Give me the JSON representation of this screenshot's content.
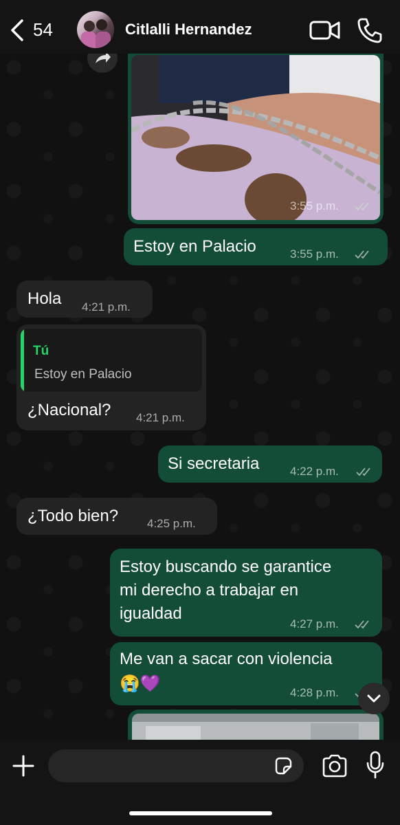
{
  "header": {
    "back_count": "54",
    "contact_name": "Citlalli Hernandez"
  },
  "messages": [
    {
      "direction": "outgoing",
      "type": "image",
      "time": "3:55 p.m."
    },
    {
      "direction": "outgoing",
      "text": "Estoy en Palacio",
      "time": "3:55 p.m."
    },
    {
      "direction": "incoming",
      "text": "Hola",
      "time": "4:21 p.m."
    },
    {
      "direction": "incoming",
      "quote_author": "Tú",
      "quote_text": "Estoy en Palacio",
      "text": "¿Nacional?",
      "time": "4:21 p.m."
    },
    {
      "direction": "outgoing",
      "text": "Si secretaria",
      "time": "4:22 p.m."
    },
    {
      "direction": "incoming",
      "text": "¿Todo bien?",
      "time": "4:25 p.m."
    },
    {
      "direction": "outgoing",
      "text_lines": [
        "Estoy buscando se garantice",
        "mi derecho a trabajar en",
        "igualdad"
      ],
      "time": "4:27 p.m."
    },
    {
      "direction": "outgoing",
      "text": "Me van a sacar con violencia",
      "emoji": "😭💜",
      "time": "4:28 p.m."
    },
    {
      "direction": "outgoing",
      "type": "image",
      "time": ""
    }
  ],
  "colors": {
    "outgoing_bubble": "#144d37",
    "incoming_bubble": "#232323",
    "quote_accent": "#25d366",
    "read_ticks": "#9fb3aa"
  },
  "icons": [
    "chevron-left-icon",
    "video-call-icon",
    "phone-icon",
    "forward-icon",
    "plus-icon",
    "sticker-icon",
    "camera-icon",
    "microphone-icon",
    "chevron-down-icon"
  ]
}
